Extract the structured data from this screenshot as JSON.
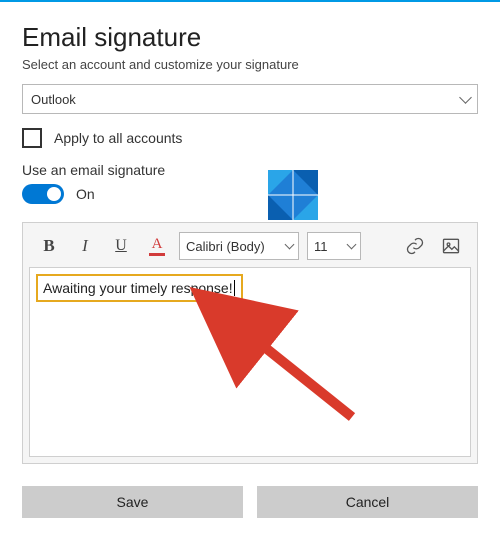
{
  "title": "Email signature",
  "subtitle": "Select an account and customize your signature",
  "account_selected": "Outlook",
  "apply_all_label": "Apply to all accounts",
  "use_signature_label": "Use an email signature",
  "toggle_state_label": "On",
  "toolbar": {
    "font_name": "Calibri (Body)",
    "font_size": "11"
  },
  "signature_text": "Awaiting your timely response!",
  "buttons": {
    "save": "Save",
    "cancel": "Cancel"
  }
}
